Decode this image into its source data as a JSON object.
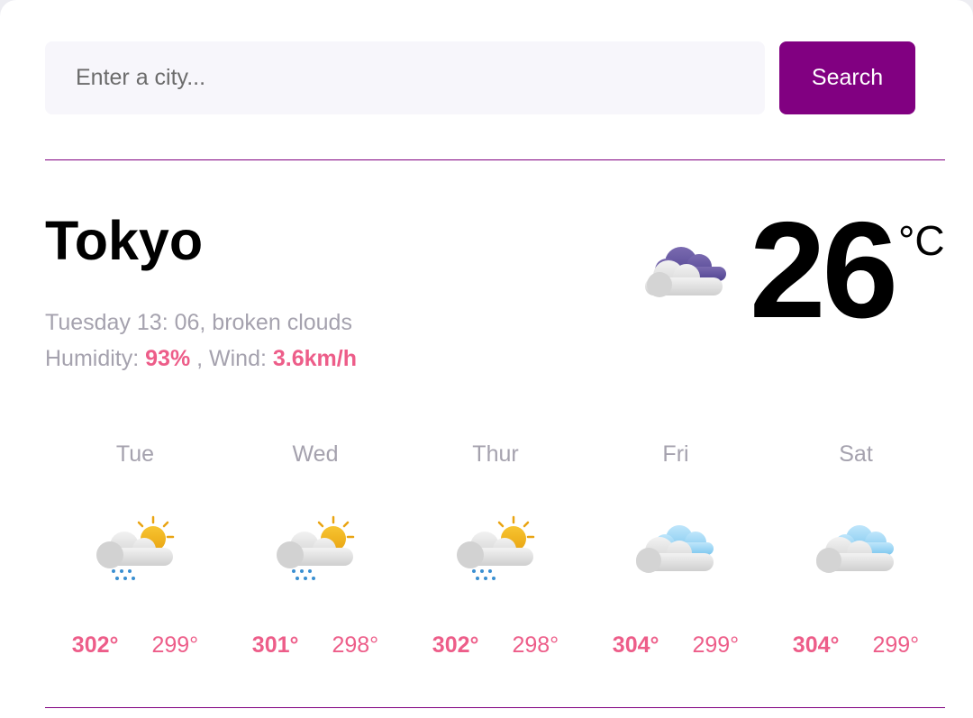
{
  "search": {
    "placeholder": "Enter a city...",
    "button_label": "Search"
  },
  "current": {
    "city": "Tokyo",
    "datetime_desc": "Tuesday 13: 06, broken clouds",
    "humidity_label": "Humidity:",
    "humidity_value": "93%",
    "wind_label": ", Wind:",
    "wind_value": "3.6km/h",
    "temperature": "26",
    "unit": "°C",
    "icon": "broken-clouds-icon"
  },
  "forecast": [
    {
      "day": "Tue",
      "max": "302°",
      "min": "299°",
      "icon": "sun-rain-cloud-icon"
    },
    {
      "day": "Wed",
      "max": "301°",
      "min": "298°",
      "icon": "sun-rain-cloud-icon"
    },
    {
      "day": "Thur",
      "max": "302°",
      "min": "298°",
      "icon": "sun-rain-cloud-icon"
    },
    {
      "day": "Fri",
      "max": "304°",
      "min": "299°",
      "icon": "clouds-icon"
    },
    {
      "day": "Sat",
      "max": "304°",
      "min": "299°",
      "icon": "clouds-icon"
    }
  ],
  "colors": {
    "accent": "#810081",
    "highlight": "#ed5d89",
    "muted_text": "#a5a2ae"
  }
}
